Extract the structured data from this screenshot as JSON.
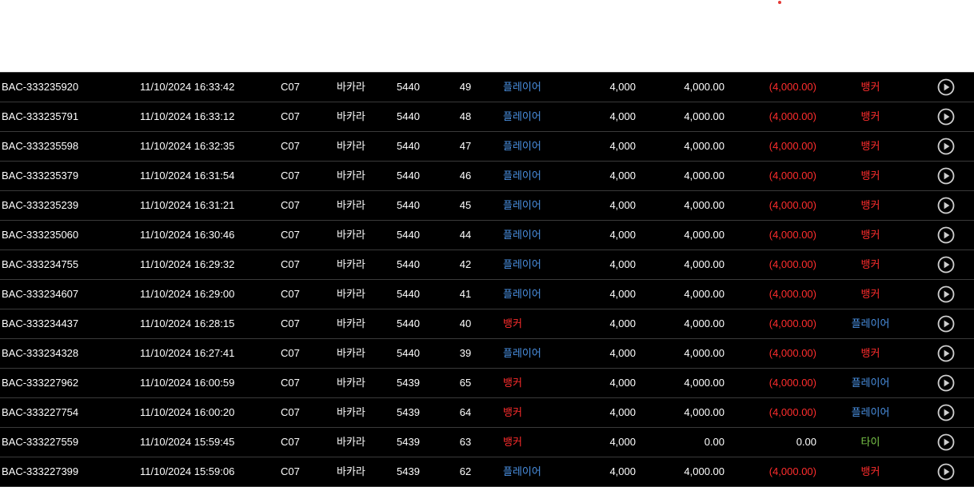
{
  "colors": {
    "player": "#4a90e2",
    "banker": "#ff2d2d",
    "tie": "#7cc94a",
    "loss": "#ff2d2d",
    "neutral": "#ffffff"
  },
  "rows": [
    {
      "id": "BAC-333235920",
      "time": "11/10/2024 16:33:42",
      "table": "C07",
      "game": "바카라",
      "shoe": "5440",
      "round": "49",
      "bet": "플레이어",
      "bet_type": "player",
      "amount": "4,000",
      "valid": "4,000.00",
      "winloss": "(4,000.00)",
      "winloss_type": "loss",
      "result": "뱅커",
      "result_type": "banker",
      "play_icon": "play-circle-icon"
    },
    {
      "id": "BAC-333235791",
      "time": "11/10/2024 16:33:12",
      "table": "C07",
      "game": "바카라",
      "shoe": "5440",
      "round": "48",
      "bet": "플레이어",
      "bet_type": "player",
      "amount": "4,000",
      "valid": "4,000.00",
      "winloss": "(4,000.00)",
      "winloss_type": "loss",
      "result": "뱅커",
      "result_type": "banker",
      "play_icon": "play-circle-icon"
    },
    {
      "id": "BAC-333235598",
      "time": "11/10/2024 16:32:35",
      "table": "C07",
      "game": "바카라",
      "shoe": "5440",
      "round": "47",
      "bet": "플레이어",
      "bet_type": "player",
      "amount": "4,000",
      "valid": "4,000.00",
      "winloss": "(4,000.00)",
      "winloss_type": "loss",
      "result": "뱅커",
      "result_type": "banker",
      "play_icon": "play-circle-icon"
    },
    {
      "id": "BAC-333235379",
      "time": "11/10/2024 16:31:54",
      "table": "C07",
      "game": "바카라",
      "shoe": "5440",
      "round": "46",
      "bet": "플레이어",
      "bet_type": "player",
      "amount": "4,000",
      "valid": "4,000.00",
      "winloss": "(4,000.00)",
      "winloss_type": "loss",
      "result": "뱅커",
      "result_type": "banker",
      "play_icon": "play-circle-icon"
    },
    {
      "id": "BAC-333235239",
      "time": "11/10/2024 16:31:21",
      "table": "C07",
      "game": "바카라",
      "shoe": "5440",
      "round": "45",
      "bet": "플레이어",
      "bet_type": "player",
      "amount": "4,000",
      "valid": "4,000.00",
      "winloss": "(4,000.00)",
      "winloss_type": "loss",
      "result": "뱅커",
      "result_type": "banker",
      "play_icon": "play-circle-icon"
    },
    {
      "id": "BAC-333235060",
      "time": "11/10/2024 16:30:46",
      "table": "C07",
      "game": "바카라",
      "shoe": "5440",
      "round": "44",
      "bet": "플레이어",
      "bet_type": "player",
      "amount": "4,000",
      "valid": "4,000.00",
      "winloss": "(4,000.00)",
      "winloss_type": "loss",
      "result": "뱅커",
      "result_type": "banker",
      "play_icon": "play-circle-icon"
    },
    {
      "id": "BAC-333234755",
      "time": "11/10/2024 16:29:32",
      "table": "C07",
      "game": "바카라",
      "shoe": "5440",
      "round": "42",
      "bet": "플레이어",
      "bet_type": "player",
      "amount": "4,000",
      "valid": "4,000.00",
      "winloss": "(4,000.00)",
      "winloss_type": "loss",
      "result": "뱅커",
      "result_type": "banker",
      "play_icon": "play-circle-icon"
    },
    {
      "id": "BAC-333234607",
      "time": "11/10/2024 16:29:00",
      "table": "C07",
      "game": "바카라",
      "shoe": "5440",
      "round": "41",
      "bet": "플레이어",
      "bet_type": "player",
      "amount": "4,000",
      "valid": "4,000.00",
      "winloss": "(4,000.00)",
      "winloss_type": "loss",
      "result": "뱅커",
      "result_type": "banker",
      "play_icon": "play-circle-icon"
    },
    {
      "id": "BAC-333234437",
      "time": "11/10/2024 16:28:15",
      "table": "C07",
      "game": "바카라",
      "shoe": "5440",
      "round": "40",
      "bet": "뱅커",
      "bet_type": "banker",
      "amount": "4,000",
      "valid": "4,000.00",
      "winloss": "(4,000.00)",
      "winloss_type": "loss",
      "result": "플레이어",
      "result_type": "player",
      "play_icon": "play-circle-icon"
    },
    {
      "id": "BAC-333234328",
      "time": "11/10/2024 16:27:41",
      "table": "C07",
      "game": "바카라",
      "shoe": "5440",
      "round": "39",
      "bet": "플레이어",
      "bet_type": "player",
      "amount": "4,000",
      "valid": "4,000.00",
      "winloss": "(4,000.00)",
      "winloss_type": "loss",
      "result": "뱅커",
      "result_type": "banker",
      "play_icon": "play-circle-icon"
    },
    {
      "id": "BAC-333227962",
      "time": "11/10/2024 16:00:59",
      "table": "C07",
      "game": "바카라",
      "shoe": "5439",
      "round": "65",
      "bet": "뱅커",
      "bet_type": "banker",
      "amount": "4,000",
      "valid": "4,000.00",
      "winloss": "(4,000.00)",
      "winloss_type": "loss",
      "result": "플레이어",
      "result_type": "player",
      "play_icon": "play-circle-icon"
    },
    {
      "id": "BAC-333227754",
      "time": "11/10/2024 16:00:20",
      "table": "C07",
      "game": "바카라",
      "shoe": "5439",
      "round": "64",
      "bet": "뱅커",
      "bet_type": "banker",
      "amount": "4,000",
      "valid": "4,000.00",
      "winloss": "(4,000.00)",
      "winloss_type": "loss",
      "result": "플레이어",
      "result_type": "player",
      "play_icon": "play-circle-icon"
    },
    {
      "id": "BAC-333227559",
      "time": "11/10/2024 15:59:45",
      "table": "C07",
      "game": "바카라",
      "shoe": "5439",
      "round": "63",
      "bet": "뱅커",
      "bet_type": "banker",
      "amount": "4,000",
      "valid": "0.00",
      "winloss": "0.00",
      "winloss_type": "neutral",
      "result": "타이",
      "result_type": "tie",
      "play_icon": "play-circle-icon"
    },
    {
      "id": "BAC-333227399",
      "time": "11/10/2024 15:59:06",
      "table": "C07",
      "game": "바카라",
      "shoe": "5439",
      "round": "62",
      "bet": "플레이어",
      "bet_type": "player",
      "amount": "4,000",
      "valid": "4,000.00",
      "winloss": "(4,000.00)",
      "winloss_type": "loss",
      "result": "뱅커",
      "result_type": "banker",
      "play_icon": "play-circle-icon"
    }
  ]
}
